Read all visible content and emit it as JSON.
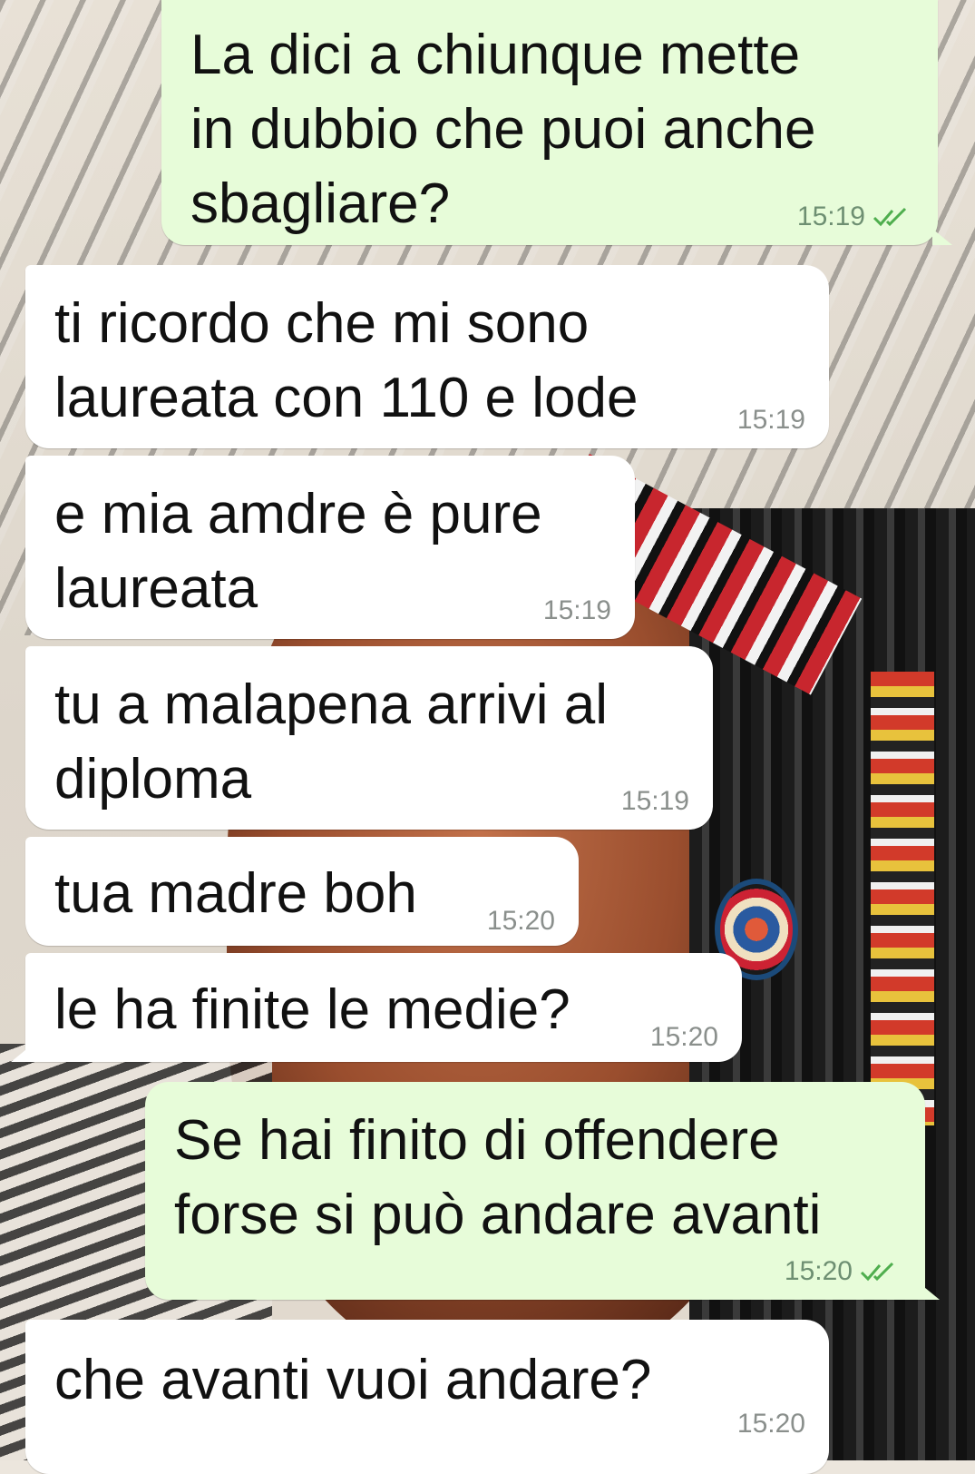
{
  "messages": [
    {
      "direction": "out",
      "text": "La dici a chiunque mette\nin dubbio che puoi anche\nsbagliare?",
      "time": "15:19",
      "status_icon": "double-check-icon"
    },
    {
      "direction": "in",
      "text": "ti ricordo che mi sono\nlaureata con 110 e lode",
      "time": "15:19"
    },
    {
      "direction": "in",
      "text": "e mia amdre è pure\nlaureata",
      "time": "15:19"
    },
    {
      "direction": "in",
      "text": "tu a malapena arrivi al\ndiploma",
      "time": "15:19"
    },
    {
      "direction": "in",
      "text": "tua madre boh",
      "time": "15:20"
    },
    {
      "direction": "in",
      "text": "le ha finite le medie?",
      "time": "15:20"
    },
    {
      "direction": "out",
      "text": "Se hai finito di offendere\nforse si può andare avanti",
      "time": "15:20",
      "status_icon": "double-check-icon"
    },
    {
      "direction": "in",
      "text": "che avanti vuoi andare?",
      "time": "15:20"
    }
  ],
  "colors": {
    "incoming_bubble": "#ffffff",
    "outgoing_bubble": "#e7fcd9",
    "read_tick": "#4fae4e",
    "time_text": "#8a8f8c"
  }
}
